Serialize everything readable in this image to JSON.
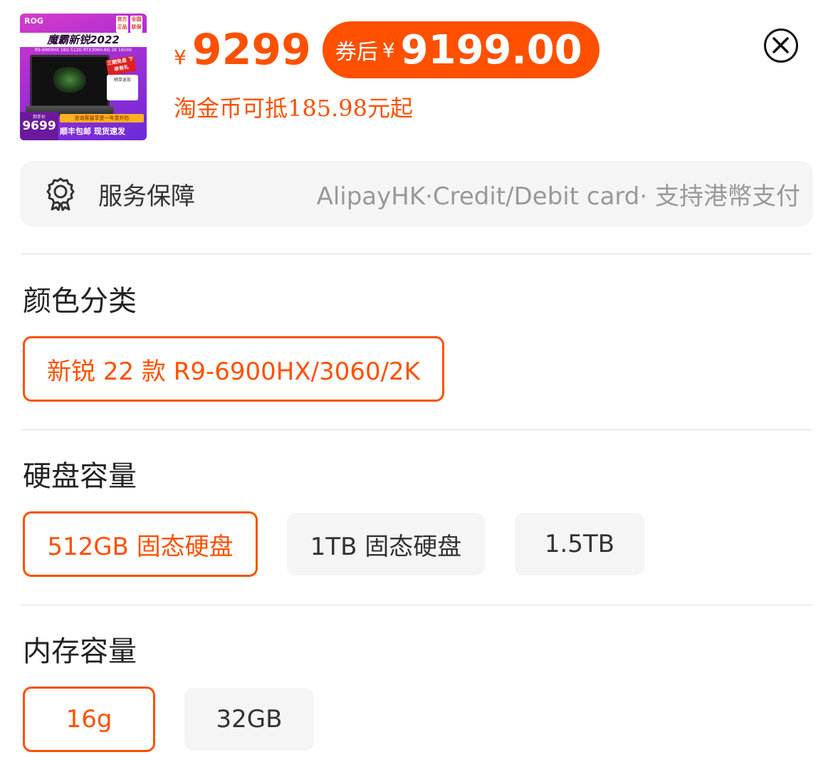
{
  "thumbnail": {
    "brand": "ROG",
    "badges": [
      "官方正品",
      "全国联保"
    ],
    "title": "魔霸新锐2022",
    "spec_line": "R9-6900HX 16G 512G RTX3060-6G 2K 165Hz",
    "promo": "三期免息 下单有礼",
    "sub_card": "晒单返现",
    "price_label": "到手价",
    "price": "9699",
    "note": "咨询客服享受一年意外险",
    "shipping": "顺丰包邮 现货速发"
  },
  "price": {
    "currency": "¥",
    "original": "9299",
    "coupon_label": "券后",
    "coupon_currency": "¥",
    "coupon_price": "9199.00",
    "coin_text": "淘金币可抵185.98元起",
    "accent_color": "#ff5000"
  },
  "close_icon": "close-icon",
  "service": {
    "icon": "badge-icon",
    "title": "服务保障",
    "description": "AlipayHK·Credit/Debit card· 支持港幣支付"
  },
  "sections": [
    {
      "title": "颜色分类",
      "options": [
        {
          "label": "新锐 22 款 R9-6900HX/3060/2K",
          "selected": true
        }
      ]
    },
    {
      "title": "硬盘容量",
      "options": [
        {
          "label": "512GB 固态硬盘",
          "selected": true
        },
        {
          "label": "1TB 固态硬盘",
          "selected": false
        },
        {
          "label": "1.5TB",
          "selected": false
        }
      ]
    },
    {
      "title": "内存容量",
      "options": [
        {
          "label": "16g",
          "selected": true
        },
        {
          "label": "32GB",
          "selected": false
        }
      ]
    }
  ]
}
